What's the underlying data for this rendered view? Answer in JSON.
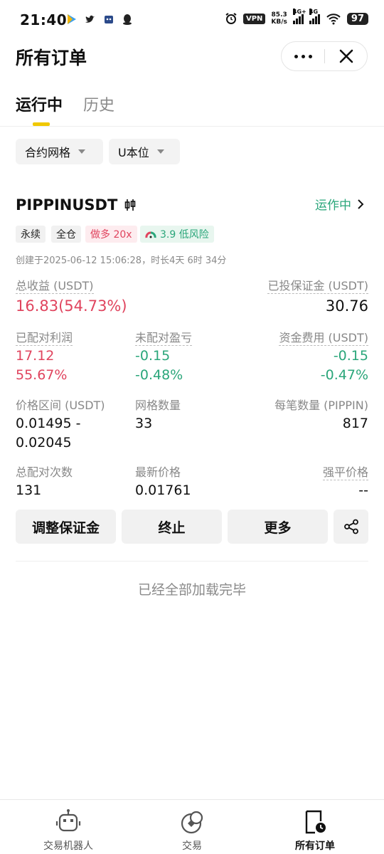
{
  "status_bar": {
    "time": "21:40",
    "vpn": "VPN",
    "speed_value": "85.3",
    "speed_unit": "KB/s",
    "signal1": "4G+",
    "signal2": "4G",
    "battery": "97"
  },
  "header": {
    "title": "所有订单"
  },
  "tabs": {
    "active": "运行中",
    "history": "历史"
  },
  "filters": {
    "contract": "合约网格",
    "margin": "U本位"
  },
  "bot": {
    "symbol": "PIPPINUSDT",
    "status": "运作中",
    "chips": {
      "perpetual": "永续",
      "cross": "全仓",
      "direction": "做多 20x",
      "risk": "3.9 低风险"
    },
    "created": "创建于2025-06-12 15:06:28，时长4天 6时 34分",
    "total_profit_label": "总收益 (USDT)",
    "total_profit_value": "16.83(54.73%)",
    "margin_label": "已投保证金 (USDT)",
    "margin_value": "30.76",
    "matched_label": "已配对利润",
    "matched_value": "17.12",
    "matched_pct": "55.67%",
    "unmatched_label": "未配对盈亏",
    "unmatched_value": "-0.15",
    "unmatched_pct": "-0.48%",
    "funding_label": "资金费用 (USDT)",
    "funding_value": "-0.15",
    "funding_pct": "-0.47%",
    "price_range_label": "价格区间 (USDT)",
    "price_low": "0.01495 -",
    "price_high": "0.02045",
    "grid_count_label": "网格数量",
    "grid_count_value": "33",
    "per_order_label": "每笔数量 (PIPPIN)",
    "per_order_value": "817",
    "total_matches_label": "总配对次数",
    "total_matches_value": "131",
    "last_price_label": "最新价格",
    "last_price_value": "0.01761",
    "liq_price_label": "强平价格",
    "liq_price_value": "--"
  },
  "actions": {
    "adjust_margin": "调整保证金",
    "stop": "终止",
    "more": "更多"
  },
  "footer_text": "已经全部加载完毕",
  "bottom_nav": {
    "bots": "交易机器人",
    "trade": "交易",
    "orders": "所有订单"
  },
  "colors": {
    "accent_yellow": "#f0c800",
    "profit_red": "#e0445e",
    "loss_green": "#2aa67a"
  }
}
